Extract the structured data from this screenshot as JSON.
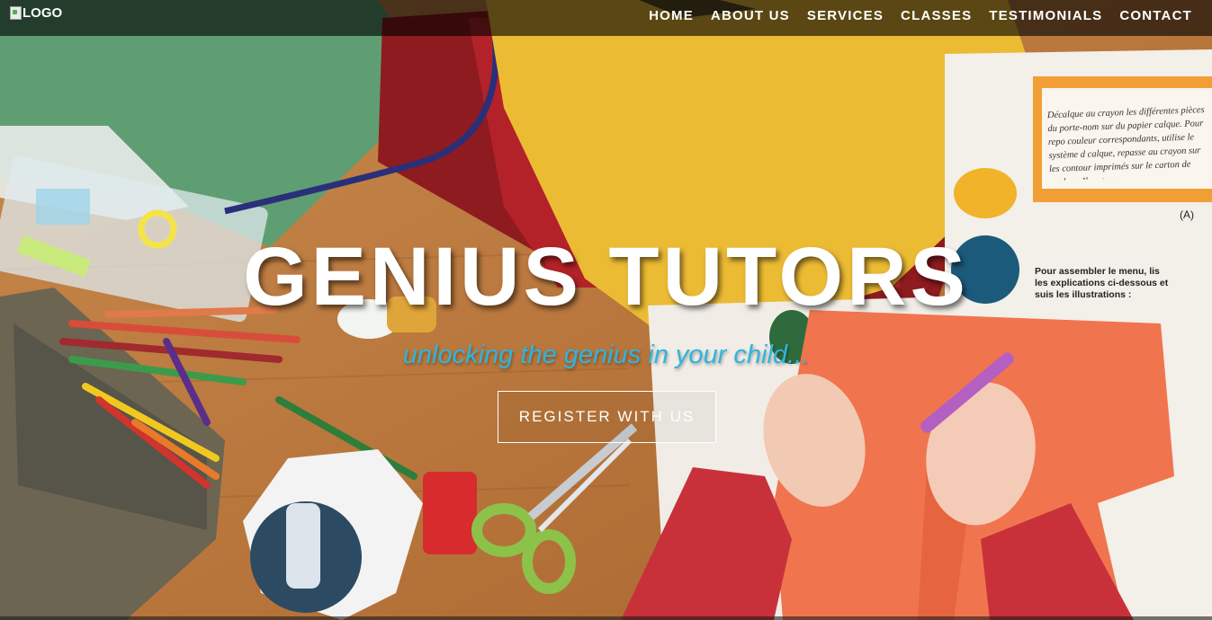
{
  "navbar": {
    "logo_text": "LOGO",
    "logo_alt_icon": "broken-image-icon",
    "links": [
      {
        "label": "HOME"
      },
      {
        "label": "ABOUT US"
      },
      {
        "label": "SERVICES"
      },
      {
        "label": "CLASSES"
      },
      {
        "label": "TESTIMONIALS"
      },
      {
        "label": "CONTACT"
      }
    ]
  },
  "hero": {
    "title": "GENIUS TUTORS",
    "tagline": "unlocking the genius in your child...",
    "cta_label": "REGISTER WITH US",
    "book_text_1": "Décalque au crayon les différentes pièces du porte-nom sur du papier calque. Pour repo couleur correspondants, utilise le système d calque, repasse au crayon sur les contour imprimés sur le carton de couleur. Il ne te r",
    "book_text_2": "Pour assembler le menu, lis les explications ci-dessous et suis les illustrations :",
    "book_label_a": "(A)"
  },
  "colors": {
    "nav_bg": "#000000",
    "title": "#ffffff",
    "tagline": "#2fb5dd",
    "button_border": "#ffffff"
  }
}
